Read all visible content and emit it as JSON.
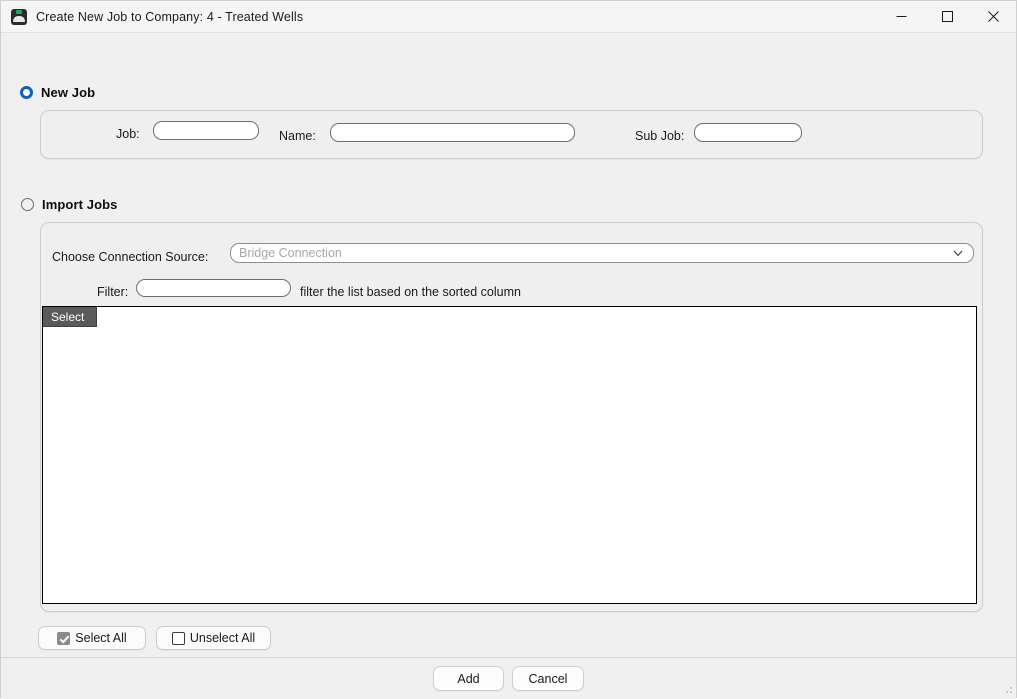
{
  "window": {
    "title": "Create New Job to Company: 4 - Treated Wells",
    "icon": "app-icon",
    "controls": {
      "minimize": "minimize-icon",
      "maximize": "maximize-icon",
      "close": "close-icon"
    }
  },
  "new_job": {
    "radio_label": "New Job",
    "selected": true,
    "fields": {
      "job_label": "Job:",
      "job_value": "",
      "job_placeholder": "",
      "name_label": "Name:",
      "name_value": "",
      "name_placeholder": "",
      "sub_job_label": "Sub Job:",
      "sub_job_value": "",
      "sub_job_placeholder": ""
    }
  },
  "import_jobs": {
    "radio_label": "Import Jobs",
    "selected": false,
    "connection": {
      "label": "Choose Connection Source:",
      "value": "Bridge Connection",
      "arrow_icon": "chevron-down-icon"
    },
    "filter": {
      "label": "Filter:",
      "value": "",
      "placeholder": "",
      "hint": "filter the list based on the sorted column"
    },
    "grid": {
      "columns": [
        "Select"
      ],
      "rows": []
    },
    "select_all_label": "Select All",
    "unselect_all_label": "Unselect All",
    "select_all_checked": true,
    "unselect_all_checked": false
  },
  "footer": {
    "add_label": "Add",
    "cancel_label": "Cancel"
  },
  "colors": {
    "accent": "#0a63c2",
    "window_bg": "#f0f0f0",
    "grid_header_bg": "#5a5a5a",
    "checkbox_checked": "#8a8a8a"
  }
}
